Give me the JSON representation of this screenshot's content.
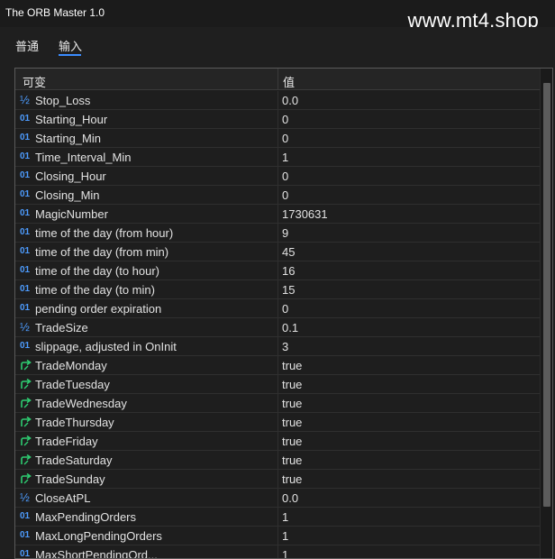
{
  "window": {
    "title": "The ORB Master 1.0",
    "watermark": "www.mt4.shop"
  },
  "tabs": [
    {
      "label": "普通"
    },
    {
      "label": "输入"
    }
  ],
  "table": {
    "headers": {
      "variable": "可变",
      "value": "值"
    },
    "rows": [
      {
        "type": "double",
        "name": "Stop_Loss",
        "value": "0.0"
      },
      {
        "type": "int",
        "name": "Starting_Hour",
        "value": "0"
      },
      {
        "type": "int",
        "name": "Starting_Min",
        "value": "0"
      },
      {
        "type": "int",
        "name": "Time_Interval_Min",
        "value": "1"
      },
      {
        "type": "int",
        "name": "Closing_Hour",
        "value": "0"
      },
      {
        "type": "int",
        "name": "Closing_Min",
        "value": "0"
      },
      {
        "type": "int",
        "name": "MagicNumber",
        "value": "1730631"
      },
      {
        "type": "int",
        "name": "time of the day (from hour)",
        "value": "9"
      },
      {
        "type": "int",
        "name": "time of the day (from min)",
        "value": "45"
      },
      {
        "type": "int",
        "name": "time of the day (to hour)",
        "value": "16"
      },
      {
        "type": "int",
        "name": "time of the day (to min)",
        "value": "15"
      },
      {
        "type": "int",
        "name": "pending order expiration",
        "value": "0"
      },
      {
        "type": "double",
        "name": "TradeSize",
        "value": "0.1"
      },
      {
        "type": "int",
        "name": "slippage, adjusted in OnInit",
        "value": "3"
      },
      {
        "type": "bool",
        "name": "TradeMonday",
        "value": "true"
      },
      {
        "type": "bool",
        "name": "TradeTuesday",
        "value": "true"
      },
      {
        "type": "bool",
        "name": "TradeWednesday",
        "value": "true"
      },
      {
        "type": "bool",
        "name": "TradeThursday",
        "value": "true"
      },
      {
        "type": "bool",
        "name": "TradeFriday",
        "value": "true"
      },
      {
        "type": "bool",
        "name": "TradeSaturday",
        "value": "true"
      },
      {
        "type": "bool",
        "name": "TradeSunday",
        "value": "true"
      },
      {
        "type": "double",
        "name": "CloseAtPL",
        "value": "0.0"
      },
      {
        "type": "int",
        "name": "MaxPendingOrders",
        "value": "1"
      },
      {
        "type": "int",
        "name": "MaxLongPendingOrders",
        "value": "1"
      },
      {
        "type": "int",
        "name": "MaxShortPendingOrd...",
        "value": "1"
      }
    ]
  },
  "icons": {
    "double": {
      "name": "double-type-icon",
      "glyph": "½",
      "color": "#4d9cff"
    },
    "int": {
      "name": "integer-type-icon",
      "glyph": "01",
      "color": "#4d9cff"
    },
    "bool": {
      "name": "boolean-type-icon",
      "color": "#2ecc71"
    }
  },
  "colors": {
    "accent": "#3b8cff",
    "background": "#1f1f1f"
  }
}
